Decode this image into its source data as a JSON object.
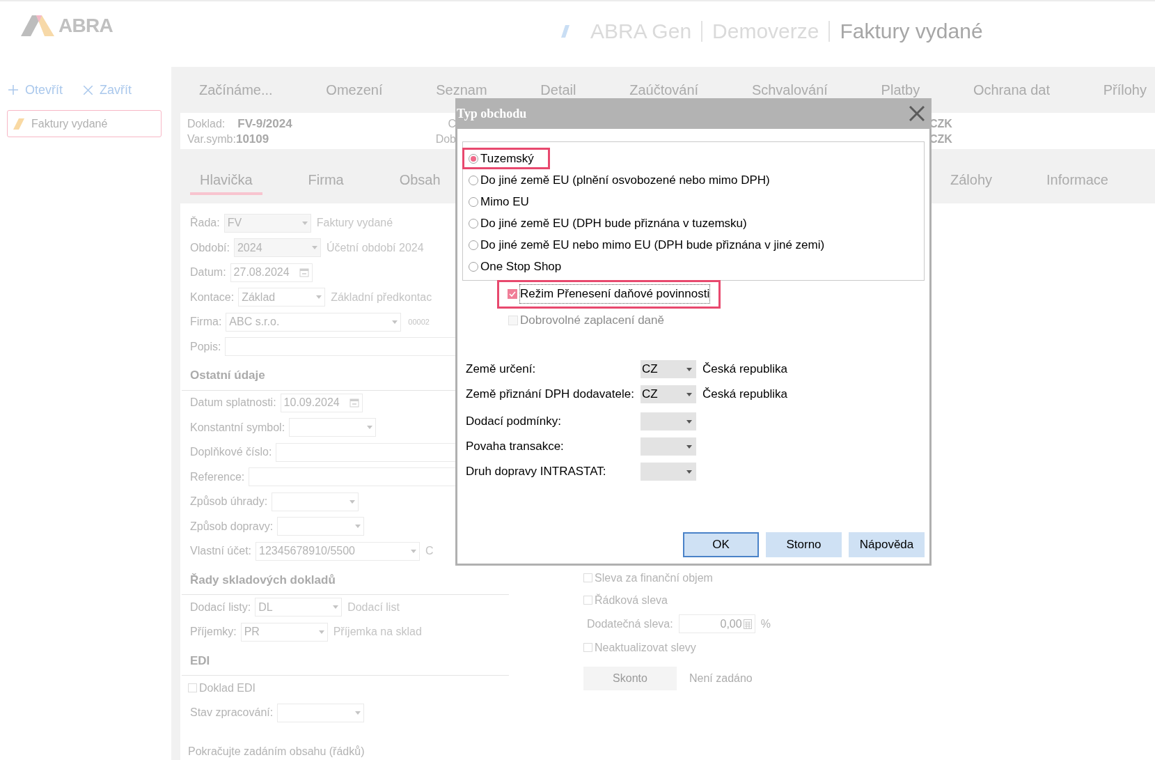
{
  "header": {
    "logo": "ABRA",
    "app": "ABRA Gen",
    "edition": "Demoverze",
    "module": "Faktury vydané"
  },
  "sidebar": {
    "actions": [
      {
        "kind": "plus",
        "label": "Otevřít"
      },
      {
        "kind": "close",
        "label": "Zavřít"
      }
    ],
    "items": [
      {
        "label": "Faktury vydané",
        "selected": true
      }
    ]
  },
  "menu": [
    "Začínáme...",
    "Omezení",
    "Seznam",
    "Detail",
    "Zaúčtování",
    "Schvalování",
    "Platby",
    "Ochrana dat",
    "Přílohy"
  ],
  "document": {
    "fields": [
      {
        "label": "Doklad:",
        "value": "FV-9/2024"
      },
      {
        "label": "Var.symb:",
        "value": "10109"
      }
    ],
    "column_2": [
      "C",
      "Dob"
    ],
    "column_3": [
      "CZK",
      "CZK"
    ]
  },
  "subtabs": {
    "left": [
      {
        "label": "Hlavička",
        "selected": true
      },
      {
        "label": "Firma",
        "selected": false
      },
      {
        "label": "Obsah",
        "selected": false
      }
    ],
    "right": [
      {
        "label": "Zálohy",
        "selected": false
      },
      {
        "label": "Informace",
        "selected": false
      }
    ]
  },
  "form": [
    {
      "kind": "combo",
      "label": "Řada:",
      "value": "FV",
      "desc": "Faktury vydané"
    },
    {
      "kind": "combo",
      "label": "Období:",
      "value": "2024",
      "desc": "Účetní období 2024"
    },
    {
      "kind": "date",
      "label": "Datum:",
      "value": "27.08.2024"
    },
    {
      "kind": "combo",
      "label": "Kontace:",
      "value": "Základ",
      "desc": "Základní předkontac"
    },
    {
      "kind": "combo",
      "label": "Firma:",
      "value": "ABC s.r.o.",
      "code": "00002"
    },
    {
      "kind": "text",
      "label": "Popis:"
    },
    {
      "kind": "heading",
      "label": "Ostatní údaje"
    },
    {
      "kind": "date",
      "label": "Datum splatnosti:",
      "value": "10.09.2024"
    },
    {
      "kind": "combo",
      "label": "Konstantní symbol:"
    },
    {
      "kind": "text",
      "label": "Doplňkové číslo:"
    },
    {
      "kind": "text",
      "label": "Reference:"
    },
    {
      "kind": "combo",
      "label": "Způsob úhrady:"
    },
    {
      "kind": "combo",
      "label": "Způsob dopravy:"
    },
    {
      "kind": "combo",
      "label": "Vlastní účet:",
      "value": "12345678910/5500",
      "desc": "C"
    },
    {
      "kind": "heading",
      "label": "Řady skladových dokladů"
    },
    {
      "kind": "combo",
      "label": "Dodací listy:",
      "value": "DL",
      "desc": "Dodací list"
    },
    {
      "kind": "combo",
      "label": "Příjemky:",
      "value": "PR",
      "desc": "Příjemka na sklad"
    },
    {
      "kind": "heading",
      "label": "EDI"
    },
    {
      "kind": "checkbox",
      "label": "Doklad EDI",
      "checked": false
    },
    {
      "kind": "combo",
      "label": "Stav zpracování:"
    },
    {
      "kind": "note",
      "label": "Pokračujte zadáním obsahu (řádků)"
    }
  ],
  "discounts": [
    {
      "kind": "checkbox",
      "label": "Sleva za finanční objem",
      "checked": false
    },
    {
      "kind": "checkbox",
      "label": "Řádková sleva",
      "checked": false
    },
    {
      "kind": "number",
      "label": "Dodatečná sleva:",
      "value": "0,00",
      "unit": "%"
    },
    {
      "kind": "checkbox",
      "label": "Neaktualizovat slevy",
      "checked": false
    },
    {
      "kind": "button",
      "label": "Skonto",
      "desc": "Není zadáno"
    }
  ],
  "dialog": {
    "title": "Typ obchodu",
    "options": [
      {
        "label": "Tuzemský",
        "selected": true,
        "highlighted": true
      },
      {
        "label": "Do jiné země EU (plnění osvobozené nebo mimo DPH)",
        "selected": false,
        "highlighted": false
      },
      {
        "label": "Mimo EU",
        "selected": false,
        "highlighted": false
      },
      {
        "label": "Do jiné země EU (DPH bude přiznána v tuzemsku)",
        "selected": false,
        "highlighted": false
      },
      {
        "label": "Do jiné země EU nebo mimo EU (DPH bude přiznána v jiné zemi)",
        "selected": false,
        "highlighted": false
      },
      {
        "label": "One Stop Shop",
        "selected": false,
        "highlighted": false
      }
    ],
    "checks": [
      {
        "label": "Režim Přenesení daňové povinnosti",
        "checked": true,
        "disabled": false,
        "highlighted": true
      },
      {
        "label": "Dobrovolné zaplacení daně",
        "checked": false,
        "disabled": true,
        "highlighted": false
      }
    ],
    "fields": [
      {
        "label": "Země určení:",
        "value": "CZ",
        "desc": "Česká republika"
      },
      {
        "label": "Země přiznání DPH dodavatele:",
        "value": "CZ",
        "desc": "Česká republika"
      },
      {
        "label": "Dodací podmínky:"
      },
      {
        "label": "Povaha transakce:"
      },
      {
        "label": "Druh dopravy INTRASTAT:"
      }
    ],
    "buttons": [
      {
        "label": "OK",
        "default": true
      },
      {
        "label": "Storno",
        "default": false
      },
      {
        "label": "Nápověda",
        "default": false
      }
    ]
  }
}
